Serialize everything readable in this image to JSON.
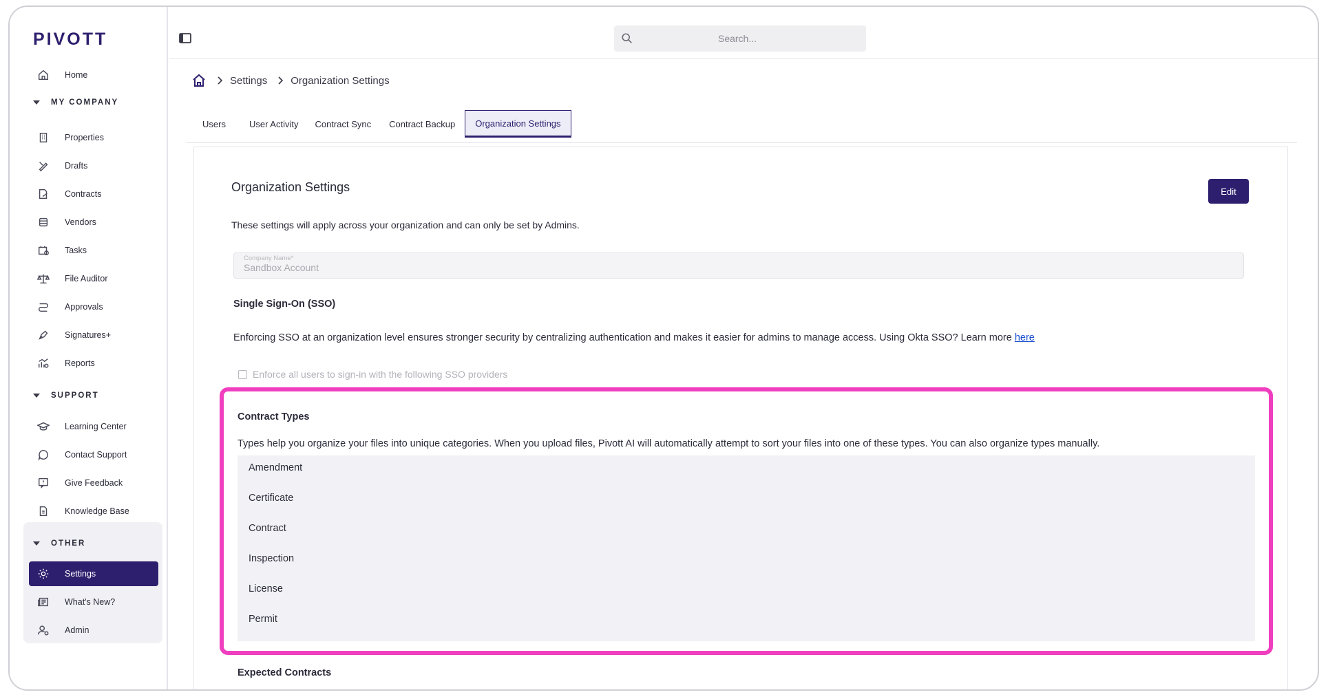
{
  "sidebar": {
    "logo": "PIVOTT",
    "home": "Home",
    "sections": {
      "my_company": "MY COMPANY",
      "support": "SUPPORT",
      "other": "OTHER"
    },
    "my_company_items": [
      "Properties",
      "Drafts",
      "Contracts",
      "Vendors",
      "Tasks",
      "File Auditor",
      "Approvals",
      "Signatures+",
      "Reports"
    ],
    "support_items": [
      "Learning Center",
      "Contact Support",
      "Give Feedback",
      "Knowledge Base"
    ],
    "other_items": [
      "Settings",
      "What's New?",
      "Admin"
    ],
    "active_item": "Settings"
  },
  "topbar": {
    "search_placeholder": "Search..."
  },
  "breadcrumb": {
    "items": [
      "Settings",
      "Organization Settings"
    ]
  },
  "tabs": {
    "items": [
      "Users",
      "User Activity",
      "Contract Sync",
      "Contract Backup",
      "Organization Settings"
    ],
    "active": "Organization Settings"
  },
  "org": {
    "title": "Organization Settings",
    "edit_label": "Edit",
    "description": "These settings will apply across your organization and can only be set by Admins.",
    "company_name_label": "Company Name*",
    "company_name_value": "Sandbox Account"
  },
  "sso": {
    "title": "Single Sign-On (SSO)",
    "description": "Enforcing SSO at an organization level ensures stronger security by centralizing authentication and makes it easier for admins to manage access. Using Okta SSO? Learn more ",
    "link": "here",
    "checkbox_label": "Enforce all users to sign-in with the following SSO providers"
  },
  "contract_types": {
    "title": "Contract Types",
    "description": "Types help you organize your files into unique categories. When you upload files, Pivott AI will automatically attempt to sort your files into one of these types. You can also organize types manually.",
    "items": [
      "Amendment",
      "Certificate",
      "Contract",
      "Inspection",
      "License",
      "Permit"
    ]
  },
  "expected_contracts": {
    "title": "Expected Contracts"
  },
  "colors": {
    "brand": "#2e1f6e",
    "highlight": "#ef3fbf",
    "link": "#1a4fd0"
  }
}
